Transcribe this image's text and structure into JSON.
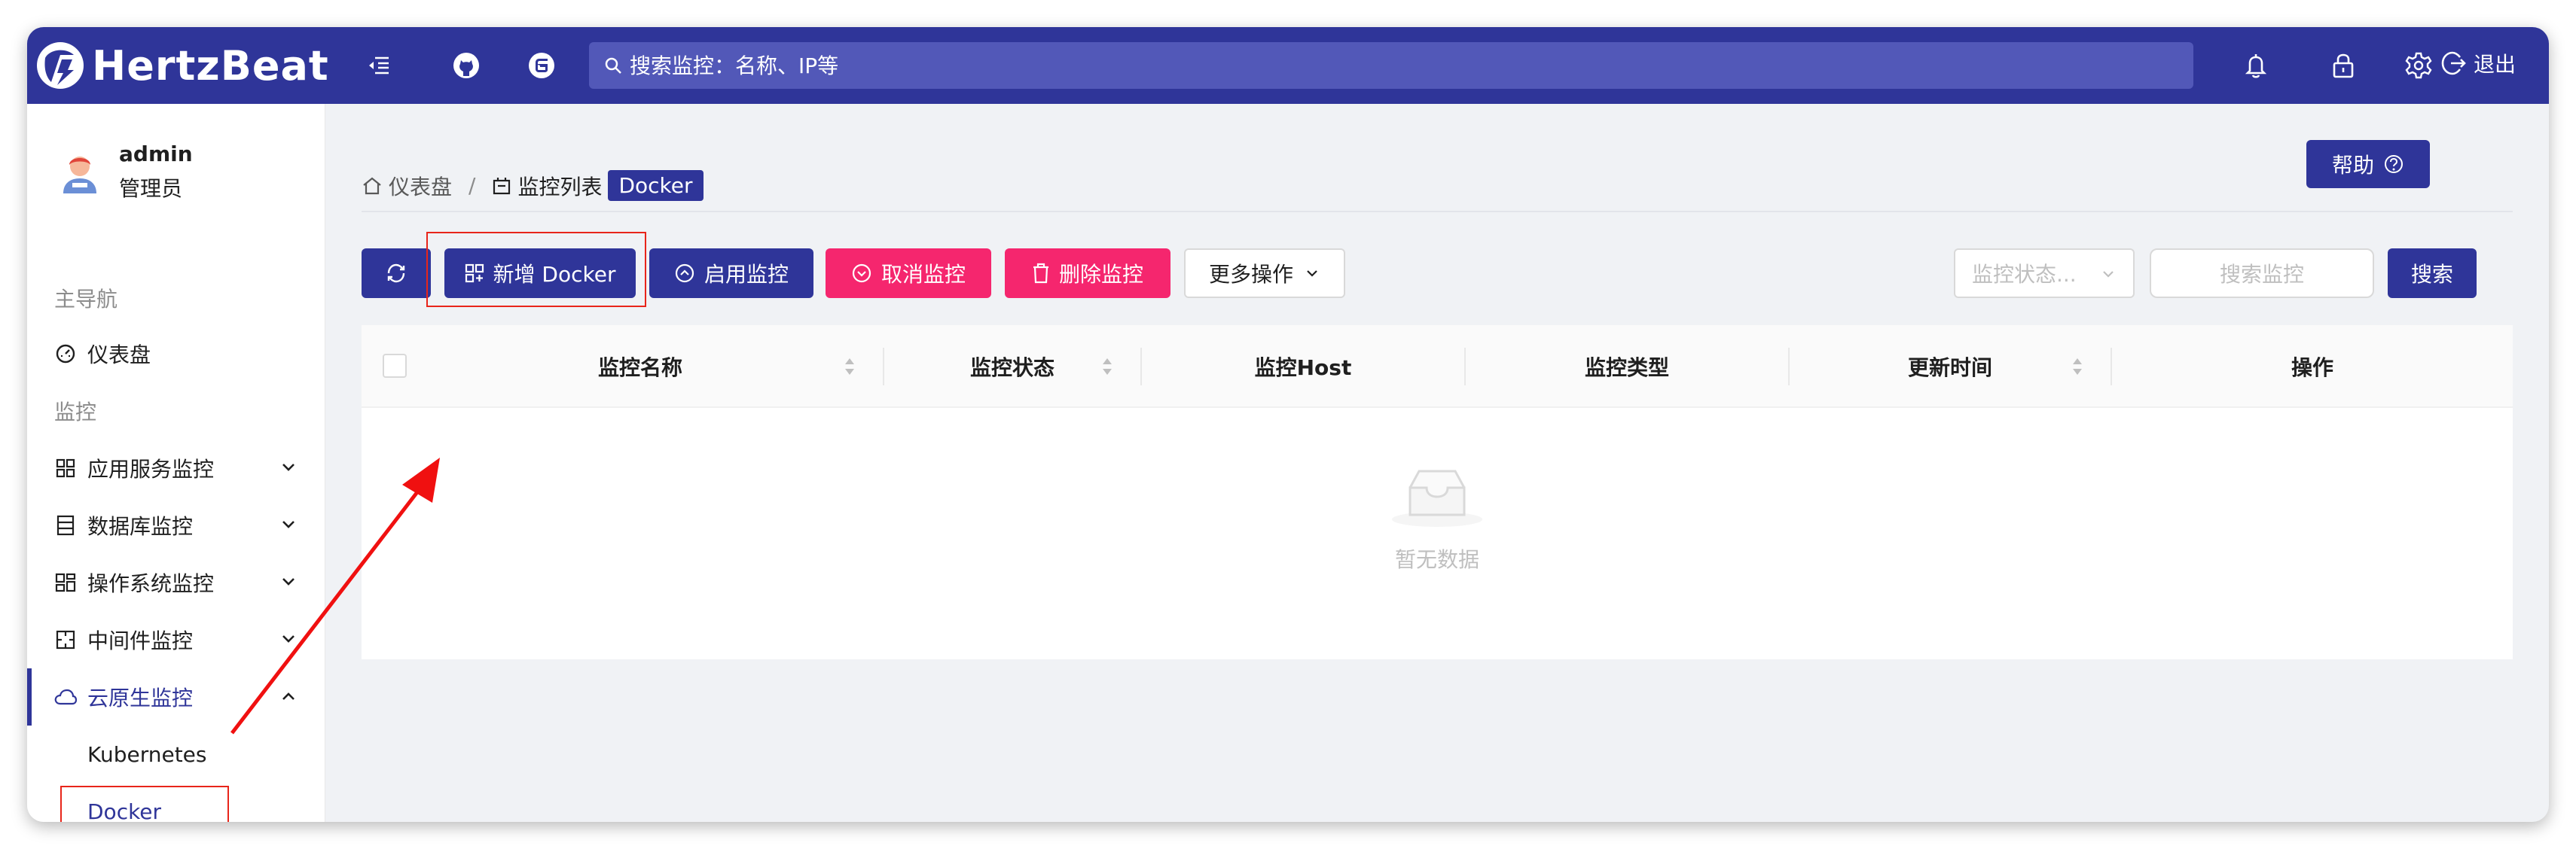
{
  "header": {
    "brand": "HertzBeat",
    "search_placeholder": "搜索监控：名称、IP等",
    "logout_label": "退出",
    "icons": [
      "menu-fold-icon",
      "github-icon",
      "gitee-icon",
      "search-icon",
      "bell-icon",
      "lock-icon",
      "gear-icon",
      "logout-icon"
    ]
  },
  "user": {
    "name": "admin",
    "role": "管理员"
  },
  "sidebar": {
    "main_nav_title": "主导航",
    "dashboard": "仪表盘",
    "monitor_title": "监控",
    "items": [
      {
        "label": "应用服务监控",
        "icon": "app-grid-icon"
      },
      {
        "label": "数据库监控",
        "icon": "database-icon"
      },
      {
        "label": "操作系统监控",
        "icon": "os-icon"
      },
      {
        "label": "中间件监控",
        "icon": "middleware-icon"
      },
      {
        "label": "云原生监控",
        "icon": "cloud-icon"
      }
    ],
    "sub_items": [
      "Kubernetes",
      "Docker"
    ]
  },
  "breadcrumb": {
    "home": "仪表盘",
    "list": "监控列表",
    "tag": "Docker"
  },
  "help_label": "帮助",
  "toolbar": {
    "add_label": "新增 Docker",
    "enable_label": "启用监控",
    "cancel_label": "取消监控",
    "delete_label": "删除监控",
    "more_label": "更多操作",
    "status_placeholder": "监控状态...",
    "search_placeholder": "搜索监控",
    "search_label": "搜索"
  },
  "table": {
    "columns": [
      "监控名称",
      "监控状态",
      "监控Host",
      "监控类型",
      "更新时间",
      "操作"
    ],
    "empty_text": "暂无数据"
  },
  "colors": {
    "primary": "#2f3599",
    "danger": "#f5266e",
    "annotation": "#e8251a"
  }
}
